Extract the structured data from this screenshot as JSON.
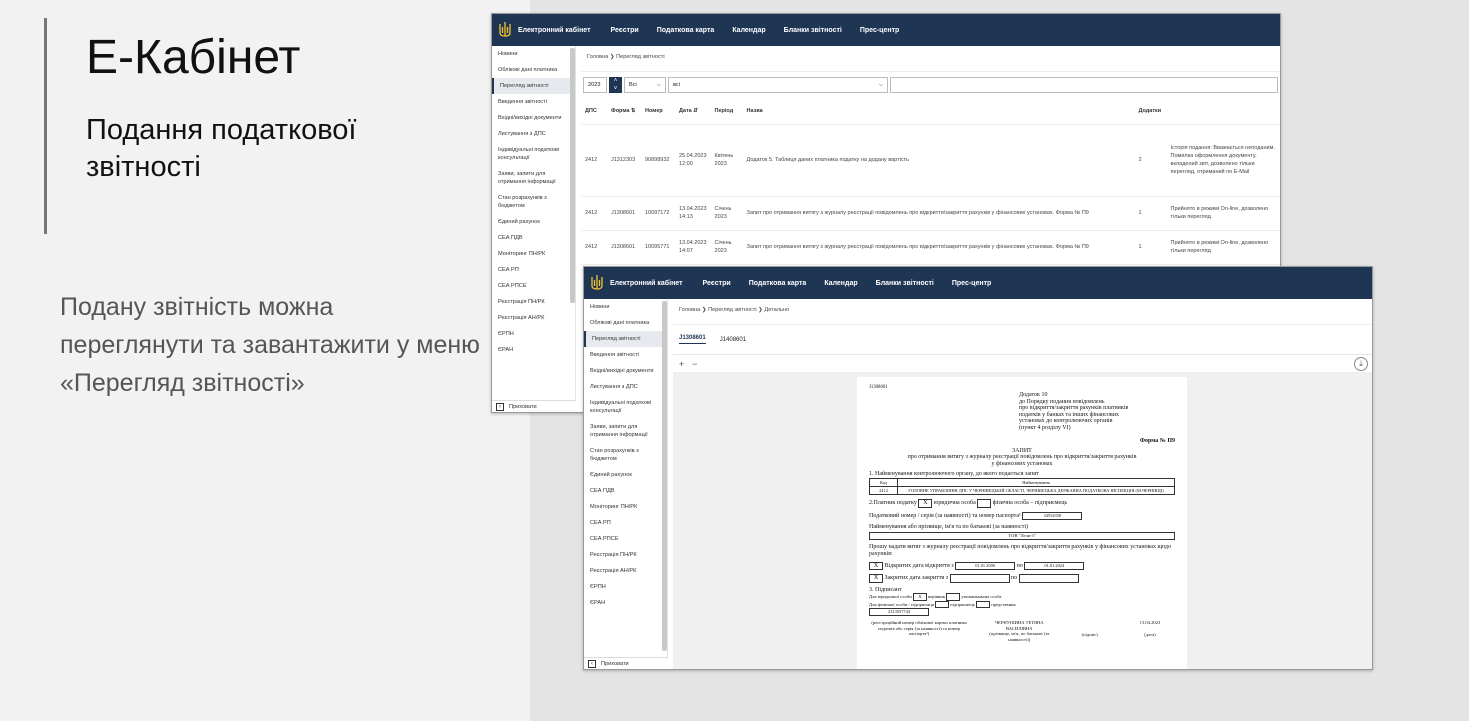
{
  "slide": {
    "title": "Е-Кабінет",
    "subtitle": "Подання податкової звітності",
    "body": "Подану звітність можна переглянути та завантажити у меню «Перегляд звітності»"
  },
  "portal": {
    "brand": "Електронний кабінет",
    "nav": [
      "Реєстри",
      "Податкова карта",
      "Календар",
      "Бланки звітності",
      "Прес-центр"
    ],
    "brand_color": "#1e3554",
    "logo_icon": "trident-icon"
  },
  "sidebar1": {
    "items": [
      "Новини",
      "Облікові дані платника",
      "Перегляд звітності",
      "Введення звітності",
      "Вхідні/вихідні документи",
      "Листування з ДПС",
      "Індивідуальні податкові консультації",
      "Заяви, запити для отримання інформації",
      "Стан розрахунків з бюджетом",
      "Єдиний рахунок",
      "СЕА ПДВ",
      "Моніторинг ПН/РК",
      "СЕА РП",
      "СЕА РПСЕ",
      "Реєстрація ПН/РК",
      "Реєстрація АН/РК",
      "ЄРПН",
      "ЄРАН"
    ],
    "active_index": 2,
    "collapse_label": "Приховати"
  },
  "sidebar2": {
    "items": [
      "Новини",
      "Облікові дані платника",
      "Перегляд звітності",
      "Введення звітності",
      "Вхідні/вихідні документи",
      "Листування з ДПС",
      "Індивідуальні податкові консультації",
      "Заяви, запити для отримання інформації",
      "Стан розрахунків з бюджетом",
      "Єдиний рахунок",
      "СЕА ПДВ",
      "Моніторинг ПН/РК",
      "СЕА РП",
      "СЕА РПСЕ",
      "Реєстрація ПН/РК",
      "Реєстрація АН/РК",
      "ЄРПН",
      "ЄРАН"
    ],
    "active_index": 2,
    "collapse_label": "Приховати"
  },
  "list_view": {
    "breadcrumb": [
      "Головна",
      "Перегляд звітності"
    ],
    "filter_year": "2023",
    "filter_type": "Всі",
    "filter_period": "всі",
    "columns": [
      "ДПС",
      "Форма ⇅",
      "Номер",
      "Дата ⇵",
      "Період",
      "Назва",
      "Додатки",
      ""
    ],
    "rows": [
      [
        "2412",
        "J1312303",
        "90898932",
        "25.04.2023 12:00",
        "Квітень 2023",
        "Додаток 5. Таблиця даних платника податку на додану вартість",
        "2",
        "Історія подання: Вважається неподаним. Помилка оформлення документу, вкладений звіт, дозволено тільки перегляд, отриманий по E-Mail"
      ],
      [
        "2412",
        "J1308601",
        "10097172",
        "13.04.2023 14:13",
        "Січень 2023",
        "Запит про отримання витягу з журналу реєстрації повідомлень про відкриття/закриття рахунків у фінансових установах. Форма № П9",
        "1",
        "Прийнято в режимі On-line, дозволено тільки перегляд"
      ],
      [
        "2412",
        "J1308601",
        "10095771",
        "13.04.2023 14:07",
        "Січень 2023",
        "Запит про отримання витягу з журналу реєстрації повідомлень про відкриття/закриття рахунків у фінансових установах. Форма № П9",
        "1",
        "Прийнято в режимі On-line, дозволено тільки перегляд"
      ]
    ]
  },
  "detail_view": {
    "breadcrumb": [
      "Головна",
      "Перегляд звітності",
      "Детально"
    ],
    "tabs": [
      "J1308601",
      "J1408601"
    ],
    "zoom_in": "+",
    "zoom_out": "−",
    "doc": {
      "code": "J1308601",
      "annex": [
        "Додаток 10",
        "до Порядку подання повідомлень",
        "про відкриття/закриття рахунків платників",
        "податків у банках та інших фінансових",
        "установах до контролюючих органів",
        "(пункт 4 розділу VI)"
      ],
      "form_no": "Форма № П9",
      "heading": [
        "ЗАПИТ",
        "про отримання витягу з журналу реєстрації повідомлень про відкриття/закриття рахунків",
        "у фінансових установах"
      ],
      "sec1": "1. Найменування контролюючого органу, до якого подається запит",
      "sec1_head_code": "Код",
      "sec1_head_name": "Найменування",
      "sec1_code": "2412",
      "sec1_name": "ГОЛОВНЕ УПРАВЛІННЯ ДПС У ЧЕРНІВЕЦЬКІЙ ОБЛАСТІ, ЧЕРНІВЕЦЬКА ДЕРЖАВНА ПОДАТКОВА ІНСПЕКЦІЯ (М.ЧЕРНІВЦІ)",
      "sec2_label": "2.Платник податку",
      "sec2_legal": "юридична особа",
      "sec2_individual": "фізична особа – підприємець",
      "sec2_mark": "X",
      "sec2_taxno_label": "Податковий номер / серія (за наявності) та номер паспорта¹",
      "sec2_taxno": "34554358",
      "sec2_name_label": "Найменування або прізвище, ім'я та по батькові (за наявності)",
      "sec2_name": "ТОВ \"Леля-3\"",
      "request": "Прошу надати витяг з журналу реєстрації повідомлень про відкриття/закриття рахунків у фінансових установах щодо рахунків:",
      "opened_label": "Відкритих",
      "opened_dates_label": "дата відкриття з",
      "opened_from": "01.01.2000",
      "opened_to": "01.01.2024",
      "closed_label": "Закритих",
      "closed_dates_label": "дата закриття з",
      "to_label": "по",
      "sec3": "3. Підписант",
      "legal_entity": "Для юридичної особи",
      "individual_entity": "Для фізичної особи - підприємця",
      "role_head": "керівник",
      "role_authorized": "уповноважена особа",
      "role_entrepreneur": "підприємець",
      "role_rep": "представник",
      "signer_code": "2313557744",
      "signer_name": "ЧЕРНУШИНА ТЕТЯНА ВАСИЛІВНА",
      "sign_date": "13.04.2023",
      "cap_reg": "(реєстраційний номер облікової картки платника податків або серія (за наявності) та номер паспорта¹)",
      "cap_name": "(прізвище, ім'я, по батькові (за наявності))",
      "cap_sign": "(підпис)",
      "cap_date": "(дата)"
    }
  }
}
